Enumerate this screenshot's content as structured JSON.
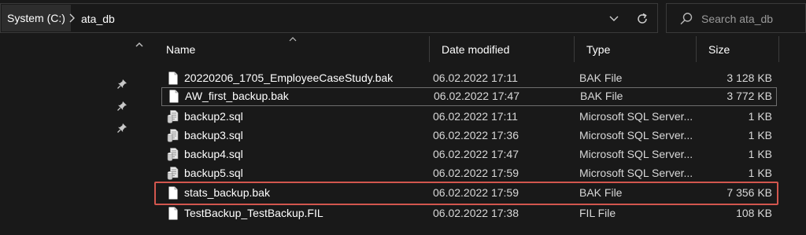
{
  "address": {
    "root_label": "System (C:)",
    "current_folder": "ata_db"
  },
  "search": {
    "placeholder": "Search ata_db"
  },
  "columns": {
    "name": "Name",
    "date": "Date modified",
    "type": "Type",
    "size": "Size"
  },
  "files": [
    {
      "name": "20220206_1705_EmployeeCaseStudy.bak",
      "date": "06.02.2022 17:11",
      "type": "BAK File",
      "size": "3 128 KB",
      "icon": "document-icon"
    },
    {
      "name": "AW_first_backup.bak",
      "date": "06.02.2022 17:47",
      "type": "BAK File",
      "size": "3 772 KB",
      "icon": "document-icon"
    },
    {
      "name": "backup2.sql",
      "date": "06.02.2022 17:11",
      "type": "Microsoft SQL Server...",
      "size": "1 KB",
      "icon": "sql-script-icon"
    },
    {
      "name": "backup3.sql",
      "date": "06.02.2022 17:36",
      "type": "Microsoft SQL Server...",
      "size": "1 KB",
      "icon": "sql-script-icon"
    },
    {
      "name": "backup4.sql",
      "date": "06.02.2022 17:47",
      "type": "Microsoft SQL Server...",
      "size": "1 KB",
      "icon": "sql-script-icon"
    },
    {
      "name": "backup5.sql",
      "date": "06.02.2022 17:59",
      "type": "Microsoft SQL Server...",
      "size": "1 KB",
      "icon": "sql-script-icon"
    },
    {
      "name": "stats_backup.bak",
      "date": "06.02.2022 17:59",
      "type": "BAK File",
      "size": "7 356 KB",
      "icon": "document-icon"
    },
    {
      "name": "TestBackup_TestBackup.FIL",
      "date": "06.02.2022 17:38",
      "type": "FIL File",
      "size": "108 KB",
      "icon": "document-icon"
    }
  ],
  "colors": {
    "background": "#191919",
    "highlight_border": "#d2564e",
    "focus_border": "#6e6e6e"
  }
}
